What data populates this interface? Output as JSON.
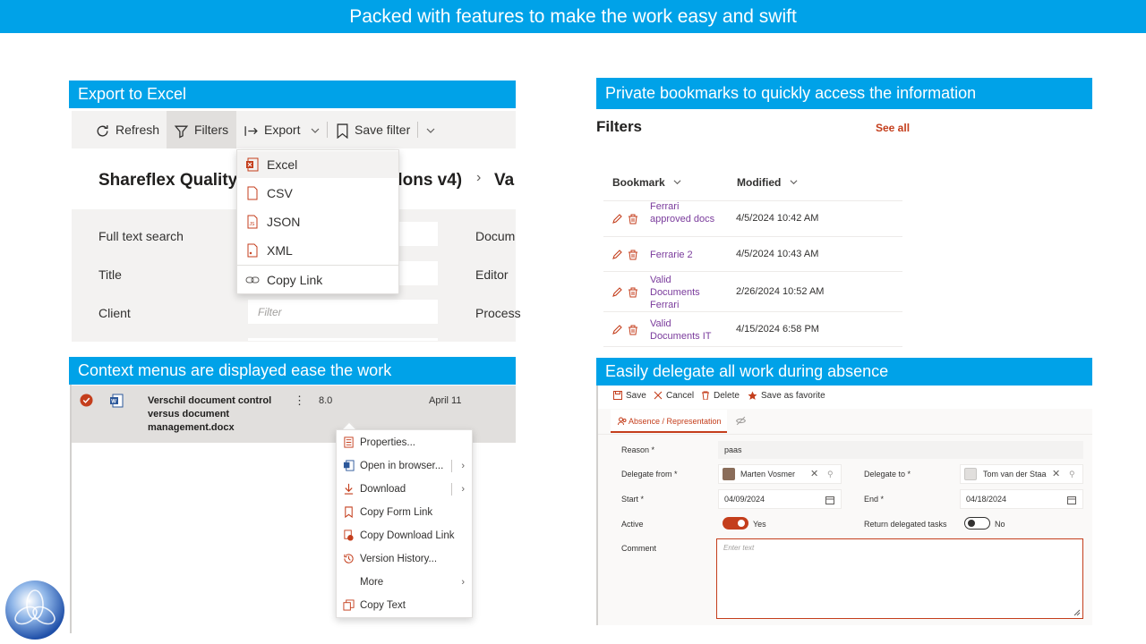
{
  "banner": "Packed with features to make the work easy and swift",
  "excel": {
    "title": "Export to Excel",
    "toolbar": {
      "refresh": "Refresh",
      "filters": "Filters",
      "export": "Export",
      "save_filter": "Save filter"
    },
    "page_title_left": "Shareflex Quality",
    "page_title_right": "dons v4)",
    "breadcrumb_sep": "›",
    "page_title_tail": "Va",
    "export_menu": [
      "Excel",
      "CSV",
      "JSON",
      "XML",
      "Copy Link"
    ],
    "form": {
      "full_text": "Full text search",
      "title": "Title",
      "client": "Client",
      "client_placeholder": "Filter",
      "right_labels": [
        "Docum",
        "Editor",
        "Process"
      ]
    }
  },
  "context": {
    "title": "Context menus are displayed ease the work",
    "row": {
      "name": "Verschil document control versus document management.docx",
      "more": "⋮",
      "version": "8.0",
      "date": "April 11"
    },
    "menu": [
      "Properties...",
      "Open in browser...",
      "Download",
      "Copy Form Link",
      "Copy Download Link",
      "Version History...",
      "More",
      "Copy Text"
    ]
  },
  "bookmarks": {
    "title": "Private bookmarks to quickly access the information",
    "filters_heading": "Filters",
    "see_all": "See all",
    "col_bookmark": "Bookmark",
    "col_modified": "Modified",
    "rows": [
      {
        "name": "Ferrari approved docs",
        "modified": "4/5/2024 10:42 AM"
      },
      {
        "name": "Ferrarie 2",
        "modified": "4/5/2024 10:43 AM"
      },
      {
        "name": "Valid Documents Ferrari",
        "modified": "2/26/2024 10:52 AM"
      },
      {
        "name": "Valid Documents IT",
        "modified": "4/15/2024 6:58 PM"
      }
    ]
  },
  "delegate": {
    "title": "Easily delegate all work during absence",
    "toolbar": {
      "save": "Save",
      "cancel": "Cancel",
      "delete": "Delete",
      "favorite": "Save as favorite"
    },
    "tab": "Absence / Representation",
    "reason_label": "Reason *",
    "reason_value": "paas",
    "delegate_from_label": "Delegate from *",
    "delegate_from_value": "Marten Vosmer",
    "delegate_to_label": "Delegate to *",
    "delegate_to_value": "Tom van der Staa",
    "start_label": "Start *",
    "start_value": "04/09/2024",
    "end_label": "End *",
    "end_value": "04/18/2024",
    "active_label": "Active",
    "active_value": "Yes",
    "return_label": "Return delegated tasks",
    "return_value": "No",
    "comment_label": "Comment",
    "comment_placeholder": "Enter text"
  },
  "colors": {
    "accent": "#00a2e8",
    "orange": "#c43e1c",
    "purple": "#7a3b9c"
  }
}
